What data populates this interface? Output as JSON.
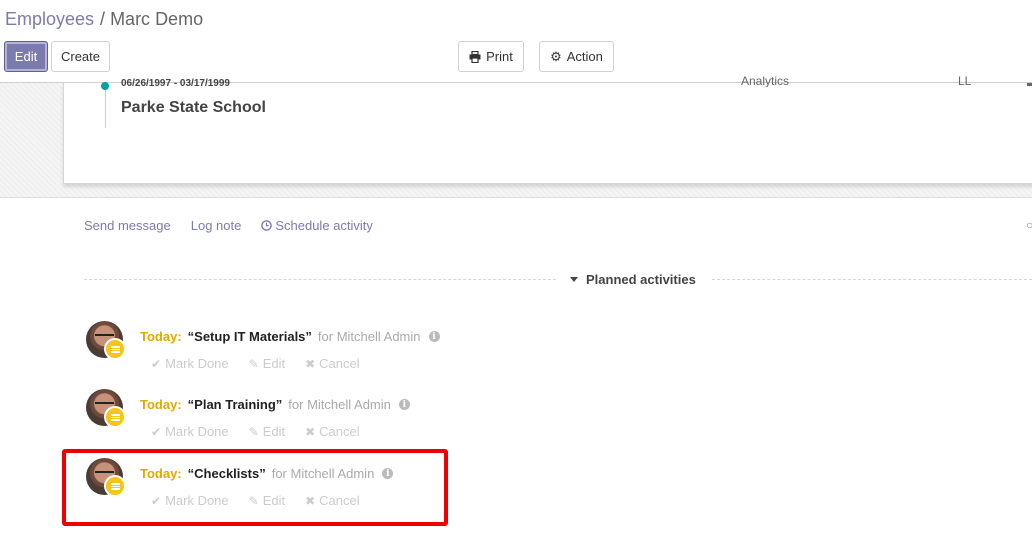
{
  "breadcrumb": {
    "parent": "Employees",
    "separator": "/",
    "current": "Marc Demo"
  },
  "buttons": {
    "edit": "Edit",
    "create": "Create",
    "print": "Print",
    "action": "Action"
  },
  "resume": {
    "dates": "06/26/1997 - 03/17/1999",
    "school": "Parke State School",
    "cutoff_skill": "Analytics",
    "cutoff_level": "LL"
  },
  "chatter": {
    "send_message": "Send message",
    "log_note": "Log note",
    "schedule_activity": "Schedule activity",
    "planned_activities": "Planned activities",
    "activities": [
      {
        "when": "Today:",
        "summary": "“Setup IT Materials”",
        "assignee": "for Mitchell Admin",
        "mark_done": "Mark Done",
        "edit": "Edit",
        "cancel": "Cancel"
      },
      {
        "when": "Today:",
        "summary": "“Plan Training”",
        "assignee": "for Mitchell Admin",
        "mark_done": "Mark Done",
        "edit": "Edit",
        "cancel": "Cancel"
      },
      {
        "when": "Today:",
        "summary": "“Checklists”",
        "assignee": "for Mitchell Admin",
        "mark_done": "Mark Done",
        "edit": "Edit",
        "cancel": "Cancel"
      }
    ]
  },
  "icons": {
    "print": "print-icon",
    "action": "gear-icon",
    "schedule": "clock-icon",
    "info": "info-icon",
    "check": "check-icon",
    "pencil": "pencil-icon",
    "times": "times-icon"
  },
  "colors": {
    "brand": "#7c7bad",
    "today": "#e0a800",
    "highlight": "#ef0000",
    "timeline": "#00a09d"
  }
}
